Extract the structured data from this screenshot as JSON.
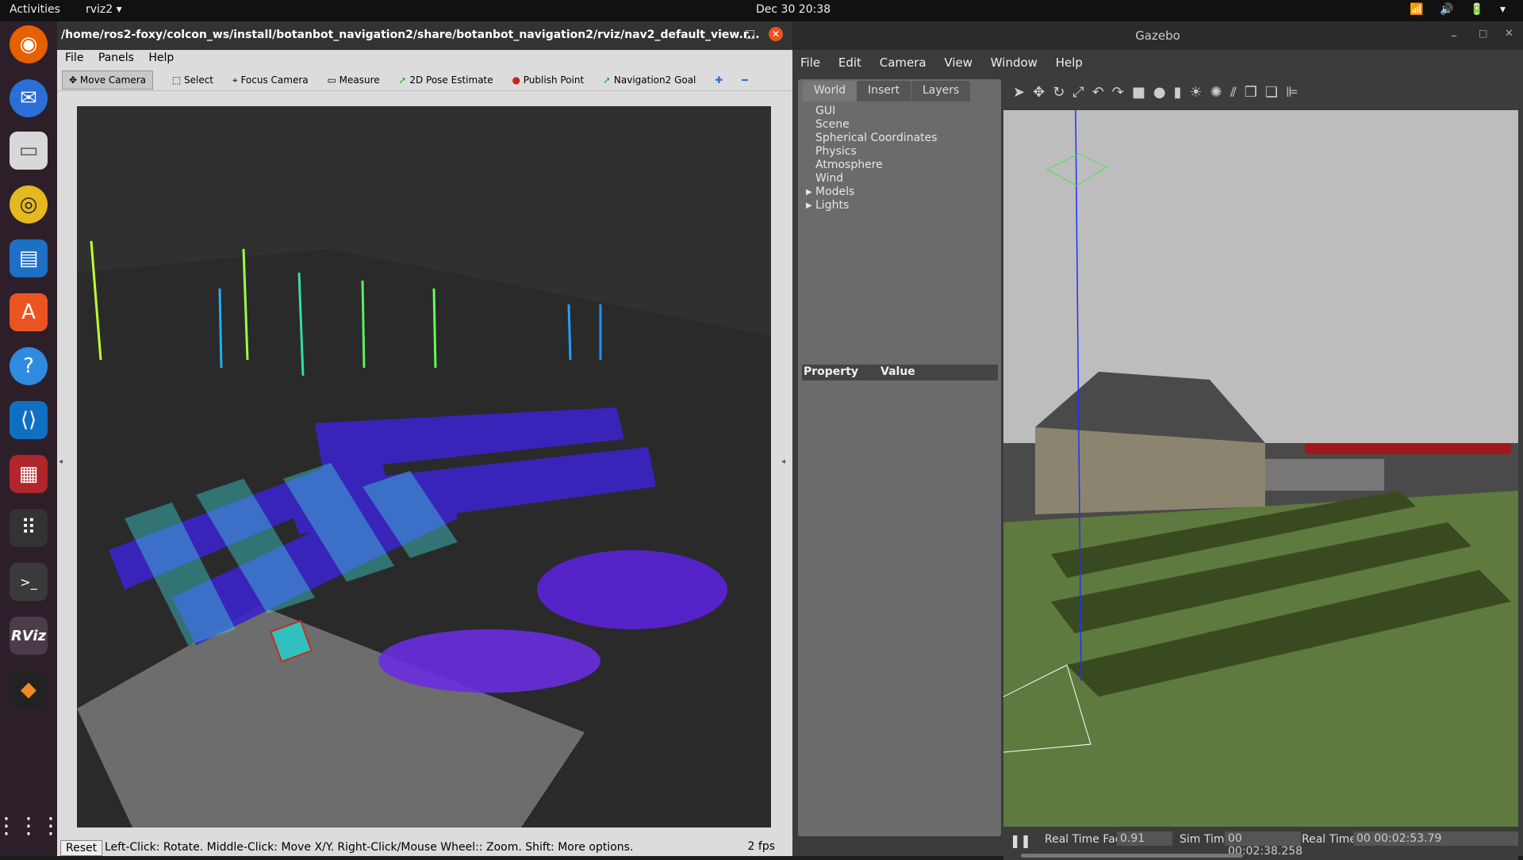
{
  "topbar": {
    "activities": "Activities",
    "app": "rviz2 ▾",
    "clock": "Dec 30  20:38"
  },
  "dock": {
    "icons": [
      "firefox-icon",
      "thunderbird-icon",
      "files-icon",
      "rhythmbox-icon",
      "writer-icon",
      "software-icon",
      "help-icon",
      "vscode-icon",
      "terminal-app-icon",
      "apps-grid-icon",
      "terminal-icon",
      "rviz-icon",
      "layers-icon",
      "show-apps-icon"
    ],
    "rviz_label": "RViz"
  },
  "rviz": {
    "title": "/home/ros2-foxy/colcon_ws/install/botanbot_navigation2/share/botanbot_navigation2/rviz/nav2_default_view.r...",
    "menu": [
      "File",
      "Panels",
      "Help"
    ],
    "tools": [
      "Move Camera",
      "Select",
      "Focus Camera",
      "Measure",
      "2D Pose Estimate",
      "Publish Point",
      "Navigation2 Goal"
    ],
    "status": {
      "reset": "Reset",
      "hint": "Left-Click: Rotate. Middle-Click: Move X/Y. Right-Click/Mouse Wheel:: Zoom. Shift: More options.",
      "fps": "2 fps"
    }
  },
  "gazebo": {
    "title": "Gazebo",
    "menu": [
      "File",
      "Edit",
      "Camera",
      "View",
      "Window",
      "Help"
    ],
    "tabs": [
      "World",
      "Insert",
      "Layers"
    ],
    "tree": [
      "GUI",
      "Scene",
      "Spherical Coordinates",
      "Physics",
      "Atmosphere",
      "Wind",
      "Models",
      "Lights"
    ],
    "property_header": [
      "Property",
      "Value"
    ],
    "footer": {
      "rtf_label": "Real Time Factor:",
      "rtf": "0.91",
      "sim_label": "Sim Time:",
      "sim": "00 00:02:38.258",
      "real_label": "Real Time:",
      "real": "00 00:02:53.79"
    }
  }
}
